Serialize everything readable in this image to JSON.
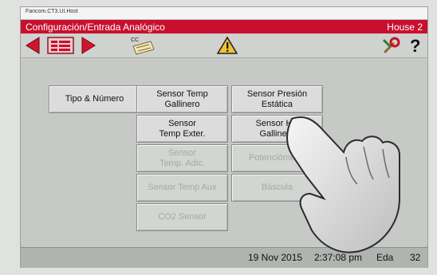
{
  "window": {
    "title": "Fancom.CT3.UI.Host"
  },
  "header": {
    "title": "Configuración/Entrada Analógico",
    "house": "House 2"
  },
  "toolbar": {
    "cc_label": "CC"
  },
  "buttons": {
    "tipo_numero": "Tipo & Número",
    "sensor_temp_gallinero": "Sensor Temp\nGallinero",
    "sensor_presion_estatica": "Sensor Presión\nEstática",
    "sensor_temp_exter": "Sensor\nTemp Exter.",
    "sensor_hr_gallinero": "Sensor HR\nGallinero",
    "sensor_temp_adic": "Sensor\nTemp. Adic.",
    "potenciometro": "Potenciómetro",
    "sensor_temp_aux": "Sensor Temp Aux",
    "bascula": "Báscula",
    "co2_sensor": "CO2 Sensor"
  },
  "status": {
    "date": "19 Nov 2015",
    "time": "2:37:08 pm",
    "lang": "Eda",
    "num": "32"
  },
  "colors": {
    "header_red": "#c8102e",
    "nav_red": "#d2142d",
    "warning_yellow": "#f1c232"
  }
}
